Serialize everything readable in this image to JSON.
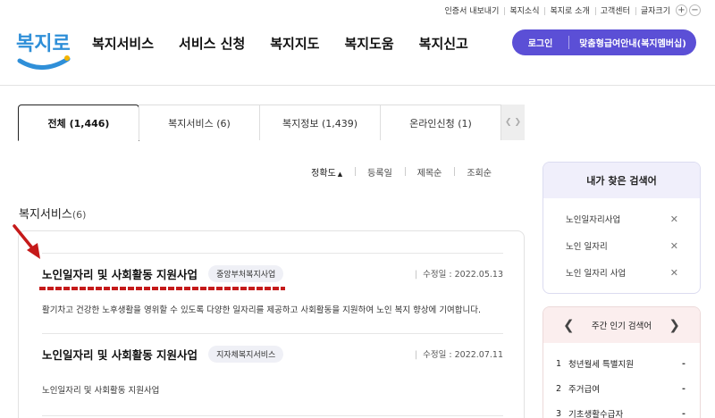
{
  "utility": {
    "links": [
      "인증서 내보내기",
      "복지소식",
      "복지로 소개",
      "고객센터"
    ],
    "font_size_label": "글자크기",
    "font_plus": "+",
    "font_minus": "−"
  },
  "header": {
    "logo_text": "복지로",
    "nav": [
      "복지서비스",
      "서비스 신청",
      "복지지도",
      "복지도움",
      "복지신고"
    ],
    "login_label": "로그인",
    "member_label": "맞춤형급여안내(복지멤버십)",
    "brand_color": "#5b4fd6"
  },
  "tabs": [
    {
      "label": "전체 (1,446)",
      "active": true
    },
    {
      "label": "복지서비스 (6)",
      "active": false
    },
    {
      "label": "복지정보 (1,439)",
      "active": false
    },
    {
      "label": "온라인신청 (1)",
      "active": false
    }
  ],
  "sort": {
    "options": [
      "정확도",
      "등록일",
      "제목순",
      "조회순"
    ],
    "active": "정확도"
  },
  "section": {
    "title": "복지서비스",
    "count": "(6)"
  },
  "results": [
    {
      "title": "노인일자리 및 사회활동 지원사업",
      "badge": "중앙부처복지사업",
      "date_label": "수정일 : 2022.05.13",
      "description": "활기차고 건강한 노후생활을 영위할 수 있도록 다양한 일자리를 제공하고 사회활동을 지원하여 노인 복지 향상에 기여합니다."
    },
    {
      "title": "노인일자리 및 사회활동 지원사업",
      "badge": "지자체복지서비스",
      "date_label": "수정일 : 2022.07.11",
      "description": "노인일자리 및 사회활동 지원사업"
    }
  ],
  "recent_searches": {
    "title": "내가 찾은 검색어",
    "items": [
      "노인일자리사업",
      "노인 일자리",
      "노인 일자리 사업"
    ]
  },
  "popular_searches": {
    "title": "주간 인기 검색어",
    "items": [
      {
        "rank": "1",
        "term": "청년월세 특별지원",
        "change": "-"
      },
      {
        "rank": "2",
        "term": "주거급여",
        "change": "-"
      },
      {
        "rank": "3",
        "term": "기초생활수급자",
        "change": "-"
      }
    ]
  },
  "annotation_color": "#c51a1a"
}
